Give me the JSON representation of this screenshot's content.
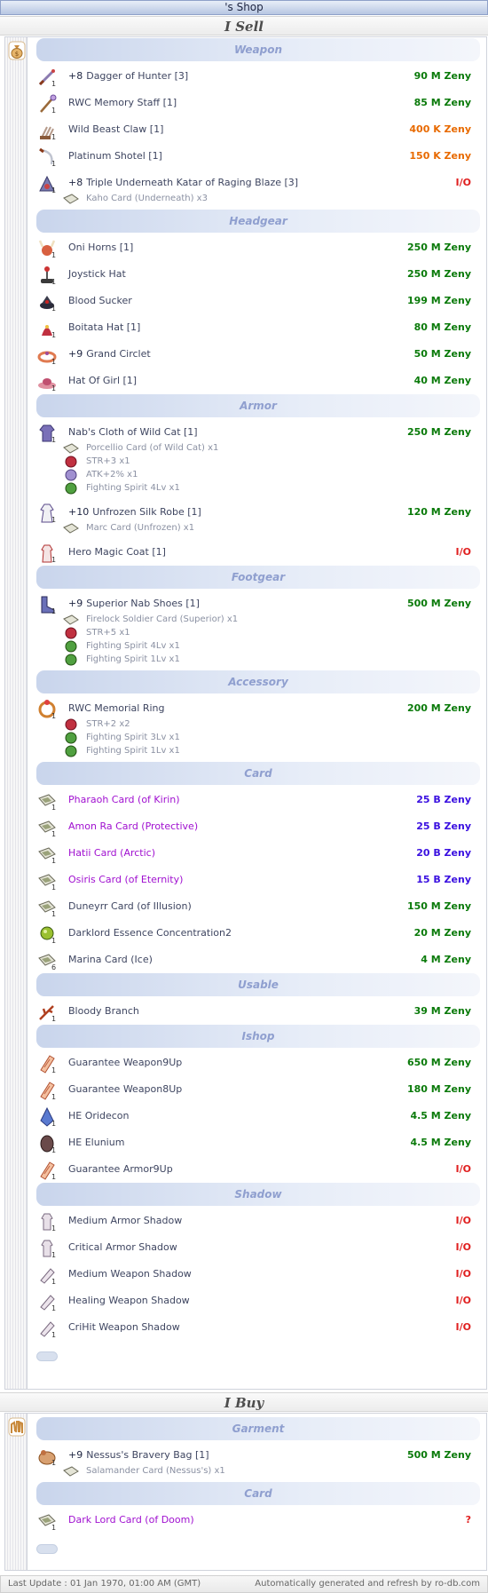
{
  "title": "'s Shop",
  "sell_heading": "I Sell",
  "buy_heading": "I Buy",
  "sell": {
    "categories": [
      {
        "name": "Weapon",
        "items": [
          {
            "ref": "+8",
            "name": "Dagger of Hunter [3]",
            "price": "90 M Zeny",
            "color": "green",
            "icon": "dagger-icon"
          },
          {
            "ref": "",
            "name": "RWC Memory Staff [1]",
            "price": "85 M Zeny",
            "color": "green",
            "icon": "staff-icon"
          },
          {
            "ref": "",
            "name": "Wild Beast Claw [1]",
            "price": "400 K Zeny",
            "color": "orange",
            "icon": "claw-icon"
          },
          {
            "ref": "",
            "name": "Platinum Shotel [1]",
            "price": "150 K Zeny",
            "color": "orange",
            "icon": "shotel-icon"
          },
          {
            "ref": "+8",
            "name": "Triple Underneath Katar of  Raging Blaze [3]",
            "price": "I/O",
            "color": "red",
            "icon": "katar-icon",
            "subs": [
              "Kaho Card (Underneath) x3"
            ]
          }
        ]
      },
      {
        "name": "Headgear",
        "items": [
          {
            "ref": "",
            "name": "Oni Horns [1]",
            "price": "250 M Zeny",
            "color": "green",
            "icon": "horns-icon"
          },
          {
            "ref": "",
            "name": "Joystick Hat",
            "price": "250 M Zeny",
            "color": "green",
            "icon": "joystick-hat-icon"
          },
          {
            "ref": "",
            "name": "Blood Sucker",
            "price": "199 M Zeny",
            "color": "green",
            "icon": "blood-sucker-icon"
          },
          {
            "ref": "",
            "name": "Boitata Hat [1]",
            "price": "80 M Zeny",
            "color": "green",
            "icon": "boitata-hat-icon"
          },
          {
            "ref": "+9",
            "name": "Grand Circlet",
            "price": "50 M Zeny",
            "color": "green",
            "icon": "circlet-icon"
          },
          {
            "ref": "",
            "name": "Hat Of Girl [1]",
            "price": "40 M Zeny",
            "color": "green",
            "icon": "girl-hat-icon"
          }
        ]
      },
      {
        "name": "Armor",
        "items": [
          {
            "ref": "",
            "name": "Nab's Cloth of Wild Cat [1]",
            "price": "250 M Zeny",
            "color": "green",
            "icon": "cloth-icon",
            "subs": [
              "Porcellio Card (of Wild Cat) x1",
              "STR+3 x1",
              "ATK+2% x1",
              "Fighting Spirit 4Lv x1"
            ]
          },
          {
            "ref": "+10",
            "name": "Unfrozen Silk Robe [1]",
            "price": "120 M Zeny",
            "color": "green",
            "icon": "robe-icon",
            "subs": [
              "Marc Card (Unfrozen) x1"
            ]
          },
          {
            "ref": "",
            "name": "Hero Magic Coat [1]",
            "price": "I/O",
            "color": "red",
            "icon": "coat-icon"
          }
        ]
      },
      {
        "name": "Footgear",
        "items": [
          {
            "ref": "+9",
            "name": "Superior Nab Shoes [1]",
            "price": "500 M Zeny",
            "color": "green",
            "icon": "shoes-icon",
            "subs": [
              "Firelock Soldier Card (Superior) x1",
              "STR+5 x1",
              "Fighting Spirit 4Lv x1",
              "Fighting Spirit 1Lv x1"
            ]
          }
        ]
      },
      {
        "name": "Accessory",
        "items": [
          {
            "ref": "",
            "name": "RWC Memorial Ring",
            "price": "200 M Zeny",
            "color": "green",
            "icon": "ring-icon",
            "subs": [
              "STR+2 x2",
              "Fighting Spirit 3Lv x1",
              "Fighting Spirit 1Lv x1"
            ]
          }
        ]
      },
      {
        "name": "Card",
        "items": [
          {
            "ref": "",
            "name": "Pharaoh Card (of Kirin)",
            "price": "25 B Zeny",
            "color": "blue",
            "name_color": "purple",
            "icon": "card-icon"
          },
          {
            "ref": "",
            "name": "Amon Ra Card (Protective)",
            "price": "25 B Zeny",
            "color": "blue",
            "name_color": "purple",
            "icon": "card-icon"
          },
          {
            "ref": "",
            "name": "Hatii Card (Arctic)",
            "price": "20 B Zeny",
            "color": "blue",
            "name_color": "purple",
            "icon": "card-icon"
          },
          {
            "ref": "",
            "name": "Osiris Card (of Eternity)",
            "price": "15 B Zeny",
            "color": "blue",
            "name_color": "purple",
            "icon": "card-icon"
          },
          {
            "ref": "",
            "name": "Duneyrr Card (of Illusion)",
            "price": "150 M Zeny",
            "color": "green",
            "icon": "card-icon"
          },
          {
            "ref": "",
            "name": "Darklord Essence Concentration2",
            "price": "20 M Zeny",
            "color": "green",
            "icon": "essence-icon"
          },
          {
            "ref": "",
            "name": "Marina Card (Ice)",
            "price": "4 M Zeny",
            "color": "green",
            "icon": "card-icon",
            "qty": "6"
          }
        ]
      },
      {
        "name": "Usable",
        "items": [
          {
            "ref": "",
            "name": "Bloody Branch",
            "price": "39 M Zeny",
            "color": "green",
            "icon": "branch-icon"
          }
        ]
      },
      {
        "name": "Ishop",
        "items": [
          {
            "ref": "",
            "name": "Guarantee Weapon9Up",
            "price": "650 M Zeny",
            "color": "green",
            "icon": "scroll-icon"
          },
          {
            "ref": "",
            "name": "Guarantee Weapon8Up",
            "price": "180 M Zeny",
            "color": "green",
            "icon": "scroll-icon"
          },
          {
            "ref": "",
            "name": "HE Oridecon",
            "price": "4.5 M Zeny",
            "color": "green",
            "icon": "oridecon-icon"
          },
          {
            "ref": "",
            "name": "HE Elunium",
            "price": "4.5 M Zeny",
            "color": "green",
            "icon": "elunium-icon"
          },
          {
            "ref": "",
            "name": "Guarantee Armor9Up",
            "price": "I/O",
            "color": "red",
            "icon": "scroll-icon"
          }
        ]
      },
      {
        "name": "Shadow",
        "items": [
          {
            "ref": "",
            "name": "Medium Armor Shadow",
            "price": "I/O",
            "color": "red",
            "icon": "shadow-armor-icon"
          },
          {
            "ref": "",
            "name": "Critical Armor Shadow",
            "price": "I/O",
            "color": "red",
            "icon": "shadow-armor-icon"
          },
          {
            "ref": "",
            "name": "Medium Weapon Shadow",
            "price": "I/O",
            "color": "red",
            "icon": "shadow-weapon-icon"
          },
          {
            "ref": "",
            "name": "Healing Weapon Shadow",
            "price": "I/O",
            "color": "red",
            "icon": "shadow-weapon-icon"
          },
          {
            "ref": "",
            "name": "CriHit Weapon Shadow",
            "price": "I/O",
            "color": "red",
            "icon": "shadow-weapon-icon"
          }
        ]
      }
    ]
  },
  "buy": {
    "categories": [
      {
        "name": "Garment",
        "items": [
          {
            "ref": "+9",
            "name": "Nessus's Bravery Bag [1]",
            "price": "500 M Zeny",
            "color": "green",
            "icon": "bag-icon",
            "subs": [
              "Salamander Card (Nessus's) x1"
            ],
            "sub_color": "red"
          }
        ]
      },
      {
        "name": "Card",
        "items": [
          {
            "ref": "",
            "name": "Dark Lord Card (of Doom)",
            "price": "?",
            "color": "red",
            "name_color": "purple",
            "icon": "card-icon"
          }
        ]
      }
    ]
  },
  "footer": {
    "last_update": "Last Update : 01 Jan 1970, 01:00 AM (GMT)",
    "generated": "Automatically generated and refresh by ro-db.com"
  },
  "colors": {
    "green": "#0a7a0a",
    "orange": "#e86a00",
    "red": "#e02020",
    "blue": "#3a10e0",
    "purple": "#a010d0",
    "category_text": "#8f9fcf"
  }
}
